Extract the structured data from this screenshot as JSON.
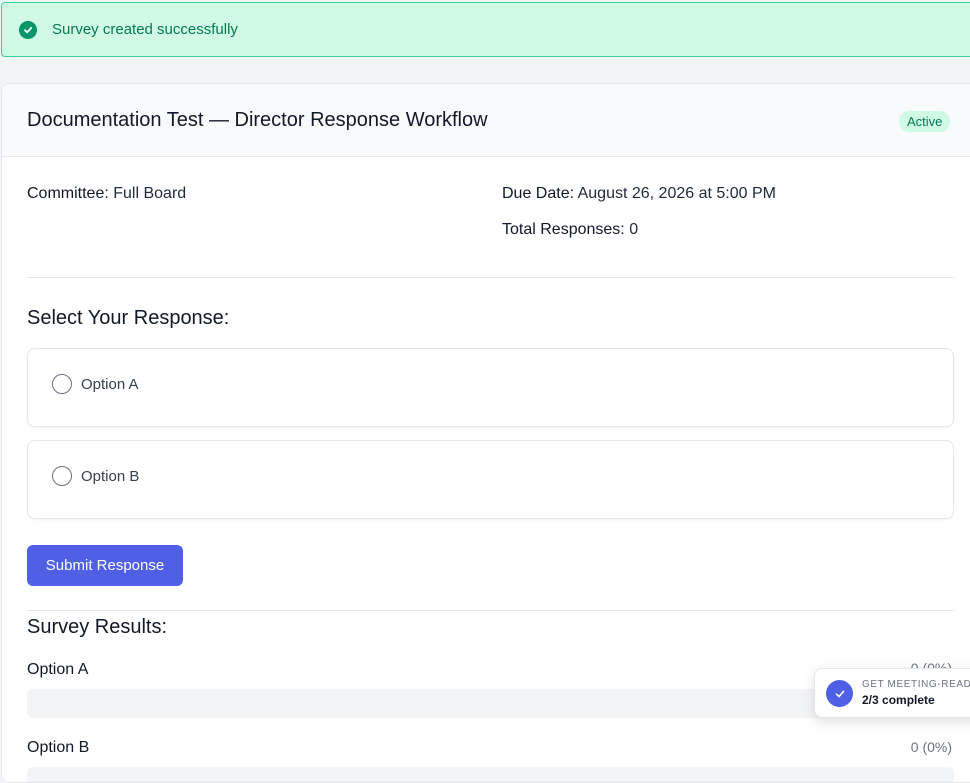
{
  "alert": {
    "icon": "check-circle-icon",
    "message": "Survey created successfully"
  },
  "survey": {
    "title": "Documentation Test — Director Response Workflow",
    "status": "Active",
    "committee_label": "Committee:",
    "committee_value": "Full Board",
    "due_date_label": "Due Date:",
    "due_date_value": "August 26, 2026 at 5:00 PM",
    "total_responses_label": "Total Responses:",
    "total_responses_value": "0"
  },
  "response_form": {
    "heading": "Select Your Response:",
    "options": [
      {
        "label": "Option A",
        "selected": false
      },
      {
        "label": "Option B",
        "selected": false
      }
    ],
    "submit_label": "Submit Response"
  },
  "results": {
    "heading": "Survey Results:",
    "items": [
      {
        "label": "Option A",
        "value": "0 (0%)",
        "percent": 0
      },
      {
        "label": "Option B",
        "value": "0 (0%)",
        "percent": 0
      }
    ]
  },
  "progress_toast": {
    "icon": "check-icon",
    "eyebrow": "GET MEETING-READY",
    "status": "2/3 complete"
  },
  "colors": {
    "success_bg": "#d1fae5",
    "success_text": "#047857",
    "primary": "#4f5fe6"
  }
}
